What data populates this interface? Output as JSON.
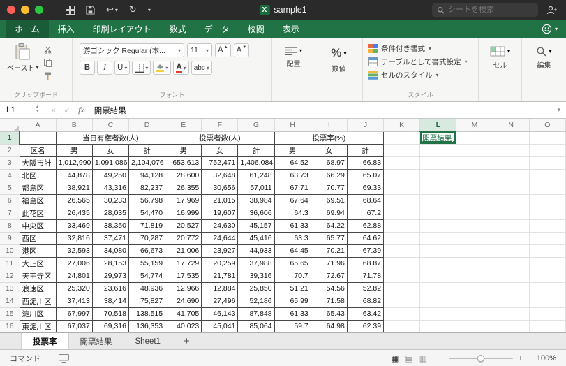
{
  "titlebar": {
    "title": "sample1",
    "search_placeholder": "シートを検索"
  },
  "ribbon_tabs": {
    "items": [
      "ホーム",
      "挿入",
      "印刷レイアウト",
      "数式",
      "データ",
      "校閲",
      "表示"
    ],
    "active_index": 0
  },
  "ribbon": {
    "paste": "ペースト",
    "group_clipboard": "クリップボード",
    "group_font": "フォント",
    "font_name": "游ゴシック Regular (本...",
    "font_size": "11",
    "bold": "B",
    "italic": "I",
    "underline": "U",
    "abc": "abc",
    "group_align": "配置",
    "group_number": "数値",
    "percent": "%",
    "group_styles": "スタイル",
    "conditional_format": "条件付き書式",
    "format_as_table": "テーブルとして書式設定",
    "cell_styles": "セルのスタイル",
    "group_cells": "セル",
    "group_editing": "編集"
  },
  "formula_bar": {
    "cell_ref": "L1",
    "fx": "fx",
    "value": "開票結果"
  },
  "sheet": {
    "col_headers": [
      "A",
      "B",
      "C",
      "D",
      "E",
      "F",
      "G",
      "H",
      "I",
      "J",
      "K",
      "L",
      "M",
      "N",
      "O"
    ],
    "active_col": "L",
    "active_row": 1,
    "first_row": 1,
    "last_row": 16,
    "group_headers": [
      {
        "label": "当日有権者数(人)",
        "span": 3
      },
      {
        "label": "投票者数(人)",
        "span": 3
      },
      {
        "label": "投票率(%)",
        "span": 3
      }
    ],
    "sub_headers": [
      "区名",
      "男",
      "女",
      "計",
      "男",
      "女",
      "計",
      "男",
      "女",
      "計"
    ],
    "hyperlink": {
      "cell": "L1",
      "text": "開票結果"
    },
    "rows": [
      [
        "大阪市計",
        "1,012,990",
        "1,091,086",
        "2,104,076",
        "653,613",
        "752,471",
        "1,406,084",
        "64.52",
        "68.97",
        "66.83"
      ],
      [
        "北区",
        "44,878",
        "49,250",
        "94,128",
        "28,600",
        "32,648",
        "61,248",
        "63.73",
        "66.29",
        "65.07"
      ],
      [
        "都島区",
        "38,921",
        "43,316",
        "82,237",
        "26,355",
        "30,656",
        "57,011",
        "67.71",
        "70.77",
        "69.33"
      ],
      [
        "福島区",
        "26,565",
        "30,233",
        "56,798",
        "17,969",
        "21,015",
        "38,984",
        "67.64",
        "69.51",
        "68.64"
      ],
      [
        "此花区",
        "26,435",
        "28,035",
        "54,470",
        "16,999",
        "19,607",
        "36,606",
        "64.3",
        "69.94",
        "67.2"
      ],
      [
        "中央区",
        "33,469",
        "38,350",
        "71,819",
        "20,527",
        "24,630",
        "45,157",
        "61.33",
        "64.22",
        "62.88"
      ],
      [
        "西区",
        "32,816",
        "37,471",
        "70,287",
        "20,772",
        "24,644",
        "45,416",
        "63.3",
        "65.77",
        "64.62"
      ],
      [
        "港区",
        "32,593",
        "34,080",
        "66,673",
        "21,006",
        "23,927",
        "44,933",
        "64.45",
        "70.21",
        "67.39"
      ],
      [
        "大正区",
        "27,006",
        "28,153",
        "55,159",
        "17,729",
        "20,259",
        "37,988",
        "65.65",
        "71.96",
        "68.87"
      ],
      [
        "天王寺区",
        "24,801",
        "29,973",
        "54,774",
        "17,535",
        "21,781",
        "39,316",
        "70.7",
        "72.67",
        "71.78"
      ],
      [
        "浪速区",
        "25,320",
        "23,616",
        "48,936",
        "12,966",
        "12,884",
        "25,850",
        "51.21",
        "54.56",
        "52.82"
      ],
      [
        "西淀川区",
        "37,413",
        "38,414",
        "75,827",
        "24,690",
        "27,496",
        "52,186",
        "65.99",
        "71.58",
        "68.82"
      ],
      [
        "淀川区",
        "67,997",
        "70,518",
        "138,515",
        "41,705",
        "46,143",
        "87,848",
        "61.33",
        "65.43",
        "63.42"
      ],
      [
        "東淀川区",
        "67,037",
        "69,316",
        "136,353",
        "40,023",
        "45,041",
        "85,064",
        "59.7",
        "64.98",
        "62.39"
      ]
    ]
  },
  "sheet_tabs": {
    "tabs": [
      "投票率",
      "開票結果",
      "Sheet1"
    ],
    "active": "投票率",
    "add": "+"
  },
  "status_bar": {
    "left": "コマンド",
    "zoom": "100%"
  },
  "icons": {
    "dropdown": "▾",
    "undo": "↩",
    "redo": "↻",
    "close": "×",
    "check": "✓",
    "up_small": "▲",
    "down_small": "▼",
    "view_normal": "▦",
    "view_page": "▤",
    "view_break": "▥",
    "minus": "−",
    "plus": "+",
    "excel_logo": "X"
  },
  "colors": {
    "excel_green": "#217346",
    "hyperlink_green": "#217346",
    "titlebar_bg": "#2a2a2a",
    "fill_yellow": "#f6d234",
    "font_red": "#e23c2e"
  }
}
